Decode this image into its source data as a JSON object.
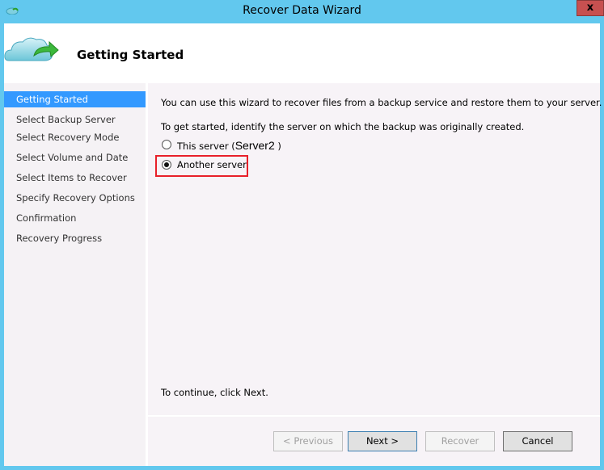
{
  "window": {
    "title": "Recover Data Wizard",
    "close_label": "x"
  },
  "header": {
    "title": "Getting Started"
  },
  "nav": {
    "items": [
      {
        "label": "Getting Started",
        "active": true
      },
      {
        "label": "Select Backup Server"
      },
      {
        "label": "Select Recovery Mode"
      },
      {
        "label": "Select Volume and Date"
      },
      {
        "label": "Select Items to Recover"
      },
      {
        "label": "Specify Recovery Options"
      },
      {
        "label": "Confirmation"
      },
      {
        "label": "Recovery Progress"
      }
    ]
  },
  "main": {
    "intro": "You can use this wizard to recover files from a backup service and restore them to your server.",
    "prompt": "To get started, identify the server on which the backup was originally created.",
    "option_this": "This server (",
    "server_name": "Server2",
    "option_this_close": ")",
    "option_another": "Another server",
    "selected": "Another server",
    "continue": "To continue, click Next."
  },
  "buttons": {
    "previous": "< Previous",
    "next": "Next >",
    "recover": "Recover",
    "cancel": "Cancel"
  },
  "colors": {
    "frame": "#62c8ee",
    "selection": "#3399ff",
    "highlight": "#e8202a"
  }
}
